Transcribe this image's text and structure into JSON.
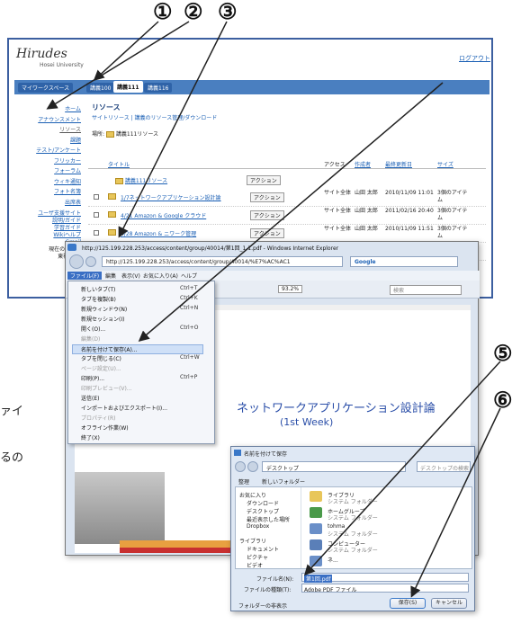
{
  "callouts": [
    "①",
    "②",
    "③",
    "④",
    "⑤",
    "⑥"
  ],
  "side_text": {
    "line1": "ァイ",
    "line2": "るの"
  },
  "lms": {
    "logo": "Hirudes",
    "logo_sub": "Hosei University",
    "top_link": "ログアウト",
    "tabs": [
      "マイワークスペース",
      "講義100",
      "講義111",
      "講義116"
    ],
    "sidebar": [
      "ホーム",
      "アナウンスメント",
      "リソース",
      "課題",
      "テスト/アンケート",
      "フリッカー",
      "フォーラム",
      "ウィキ通知",
      "フォト名簿",
      "出席表"
    ],
    "sidebar2": [
      "ユーザ支援サイト",
      "説明/ガイド",
      "学習ガイド",
      "Wikiヘルプ",
      "Gmail",
      "現在のユーザ",
      "東社 三郎"
    ],
    "heading": "リソース",
    "breadcrumb": "サイトリソース  |  講義のリソース管理/ダウンロード",
    "location_label": "場所:",
    "location_value": "講義111リソース",
    "columns": [
      "タイトル",
      "アクセス",
      "作成者",
      "最終更新日",
      "サイズ"
    ],
    "folder_row": "講義111リソース",
    "action_label": "アクション",
    "rows": [
      {
        "title": "1/7ネットワークアプリケーション設計論",
        "access": "サイト全体",
        "creator": "山田 太郎",
        "date": "2010/11/09 11:01",
        "size": "3個のアイテム"
      },
      {
        "title": "4/21 Amazon & Google クラウド",
        "access": "サイト全体",
        "creator": "山田 太郎",
        "date": "2011/02/16 20:40",
        "size": "3個のアイテム"
      },
      {
        "title": "4/28 Amazon & ニワーク管理",
        "access": "サイト全体",
        "creator": "山田 太郎",
        "date": "2010/11/09 11:51",
        "size": "3個のアイテム"
      },
      {
        "title": "",
        "access": "サイト全体",
        "creator": "山田 太郎",
        "date": "2010/11/09",
        "size": "3個のアイテム"
      }
    ]
  },
  "ie": {
    "title": "http://125.199.228.253/access/content/group/40014/第1回_1.1.pdf - Windows Internet Explorer",
    "address": "http://125.199.228.253/access/content/group/40014/%E7%AC%AC1",
    "search_engine": "Google",
    "menubar": [
      "ファイル(F)",
      "編集",
      "表示(V)",
      "お気に入り(A)",
      "ヘルプ"
    ],
    "zoom": "93.2%",
    "search_placeholder": "検索",
    "file_menu": [
      {
        "label": "新しいタブ(T)",
        "key": "Ctrl+T",
        "disabled": false
      },
      {
        "label": "タブを複製(B)",
        "key": "Ctrl+K",
        "disabled": false
      },
      {
        "label": "新規ウィンドウ(N)",
        "key": "Ctrl+N",
        "disabled": false
      },
      {
        "label": "新規セッション(I)",
        "key": "",
        "disabled": false
      },
      {
        "label": "開く(O)...",
        "key": "Ctrl+O",
        "disabled": false
      },
      {
        "label": "編集(D)",
        "key": "",
        "disabled": true
      },
      {
        "label": "名前を付けて保存(A)...",
        "key": "",
        "disabled": false
      },
      {
        "label": "タブを閉じる(C)",
        "key": "Ctrl+W",
        "disabled": false
      },
      {
        "label": "ページ設定(U)...",
        "key": "",
        "disabled": true
      },
      {
        "label": "印刷(P)...",
        "key": "Ctrl+P",
        "disabled": false
      },
      {
        "label": "印刷プレビュー(V)...",
        "key": "",
        "disabled": true
      },
      {
        "label": "送信(E)",
        "key": "",
        "disabled": false
      },
      {
        "label": "インポートおよびエクスポート(I)...",
        "key": "",
        "disabled": false
      },
      {
        "label": "プロパティ(R)",
        "key": "",
        "disabled": true
      },
      {
        "label": "オフライン作業(W)",
        "key": "",
        "disabled": false
      },
      {
        "label": "終了(X)",
        "key": "",
        "disabled": false
      }
    ],
    "doc_title": "ネットワークアプリケーション設計論",
    "doc_sub": "(1st Week)"
  },
  "dialog": {
    "title": "名前を付けて保存",
    "path": "デスクトップ",
    "search": "デスクトップの検索",
    "toolbar": [
      "整理",
      "新しいフォルダー"
    ],
    "tree": [
      "お気に入り",
      "ダウンロード",
      "デスクトップ",
      "最近表示した場所",
      "Dropbox",
      "ライブラリ",
      "ドキュメント",
      "ピクチャ",
      "ビデオ"
    ],
    "files": [
      {
        "name": "ライブラリ",
        "type": "システム フォルダー"
      },
      {
        "name": "ホームグループ",
        "type": "システム フォルダー"
      },
      {
        "name": "tohma",
        "type": "システム フォルダー"
      },
      {
        "name": "コンピューター",
        "type": "システム フォルダー"
      },
      {
        "name": "ネ...",
        "type": ""
      }
    ],
    "filename_label": "ファイル名(N):",
    "filename_value": "第1回.pdf",
    "filetype_label": "ファイルの種類(T):",
    "filetype_value": "Adobe PDF ファイル",
    "hide_folders": "フォルダーの非表示",
    "save": "保存(S)",
    "cancel": "キャンセル"
  }
}
